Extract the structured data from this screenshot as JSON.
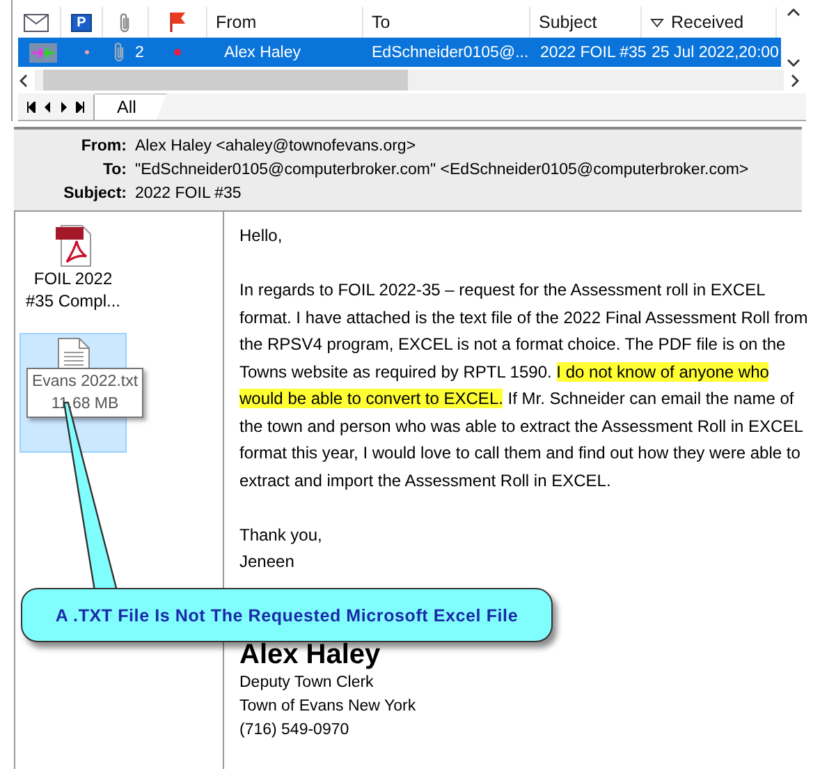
{
  "message_list": {
    "columns": [
      {
        "kind": "envelope"
      },
      {
        "kind": "priority",
        "label": "P"
      },
      {
        "kind": "attachment"
      },
      {
        "kind": "flag"
      },
      {
        "kind": "text",
        "label": "From"
      },
      {
        "kind": "text",
        "label": "To"
      },
      {
        "kind": "text",
        "label": "Subject"
      },
      {
        "kind": "sorted",
        "label": "Received"
      }
    ],
    "rows": [
      {
        "selected": true,
        "attachments": "2",
        "from": "Alex Haley",
        "to": "EdSchneider0105@...",
        "subject": "2022 FOIL #35",
        "received": "25 Jul 2022,20:00"
      }
    ]
  },
  "tabs": [
    {
      "label": "All",
      "selected": true
    }
  ],
  "header": [
    {
      "label": "From:",
      "value": "Alex Haley <ahaley@townofevans.org>"
    },
    {
      "label": "To:",
      "value": "\"EdSchneider0105@computerbroker.com\" <EdSchneider0105@computerbroker.com>"
    },
    {
      "label": "Subject:",
      "value": "2022 FOIL #35"
    }
  ],
  "attachments": [
    {
      "kind": "pdf",
      "label": "FOIL 2022 #35 Compl...",
      "selected": false
    },
    {
      "kind": "txt",
      "label": "Evans 2022.txt 11.68 MB",
      "selected": true
    }
  ],
  "body": [
    {
      "segments": [
        {
          "text": "Hello,",
          "highlighted": false
        }
      ]
    },
    {
      "segments": [
        {
          "text": "In regards to FOIL 2022-35 – request for the Assessment roll in EXCEL format.   I have attached is the text file of the 2022 Final Assessment Roll from the RPSV4 program, EXCEL is not a format choice. The PDF file is on the Towns website as required by RPTL 1590. ",
          "highlighted": false
        },
        {
          "text": "I do not know of anyone who would be able to convert to EXCEL.",
          "highlighted": true
        },
        {
          "text": " If Mr. Schneider can email the name of the town and person who was able to extract the Assessment Roll in EXCEL format this year, I would love to call them and find out how they were able to extract and import the Assessment Roll in EXCEL.",
          "highlighted": false
        }
      ]
    },
    {
      "segments": [
        {
          "text": "Thank you,",
          "highlighted": false
        }
      ]
    },
    {
      "segments": [
        {
          "text": "Jeneen",
          "highlighted": false
        }
      ]
    }
  ],
  "signature": {
    "name": "Alex Haley",
    "lines": [
      "Deputy Town Clerk",
      "Town of Evans New York",
      "(716) 549-0970"
    ]
  },
  "callout": {
    "text": "A .TXT File Is Not The Requested Microsoft Excel File"
  }
}
